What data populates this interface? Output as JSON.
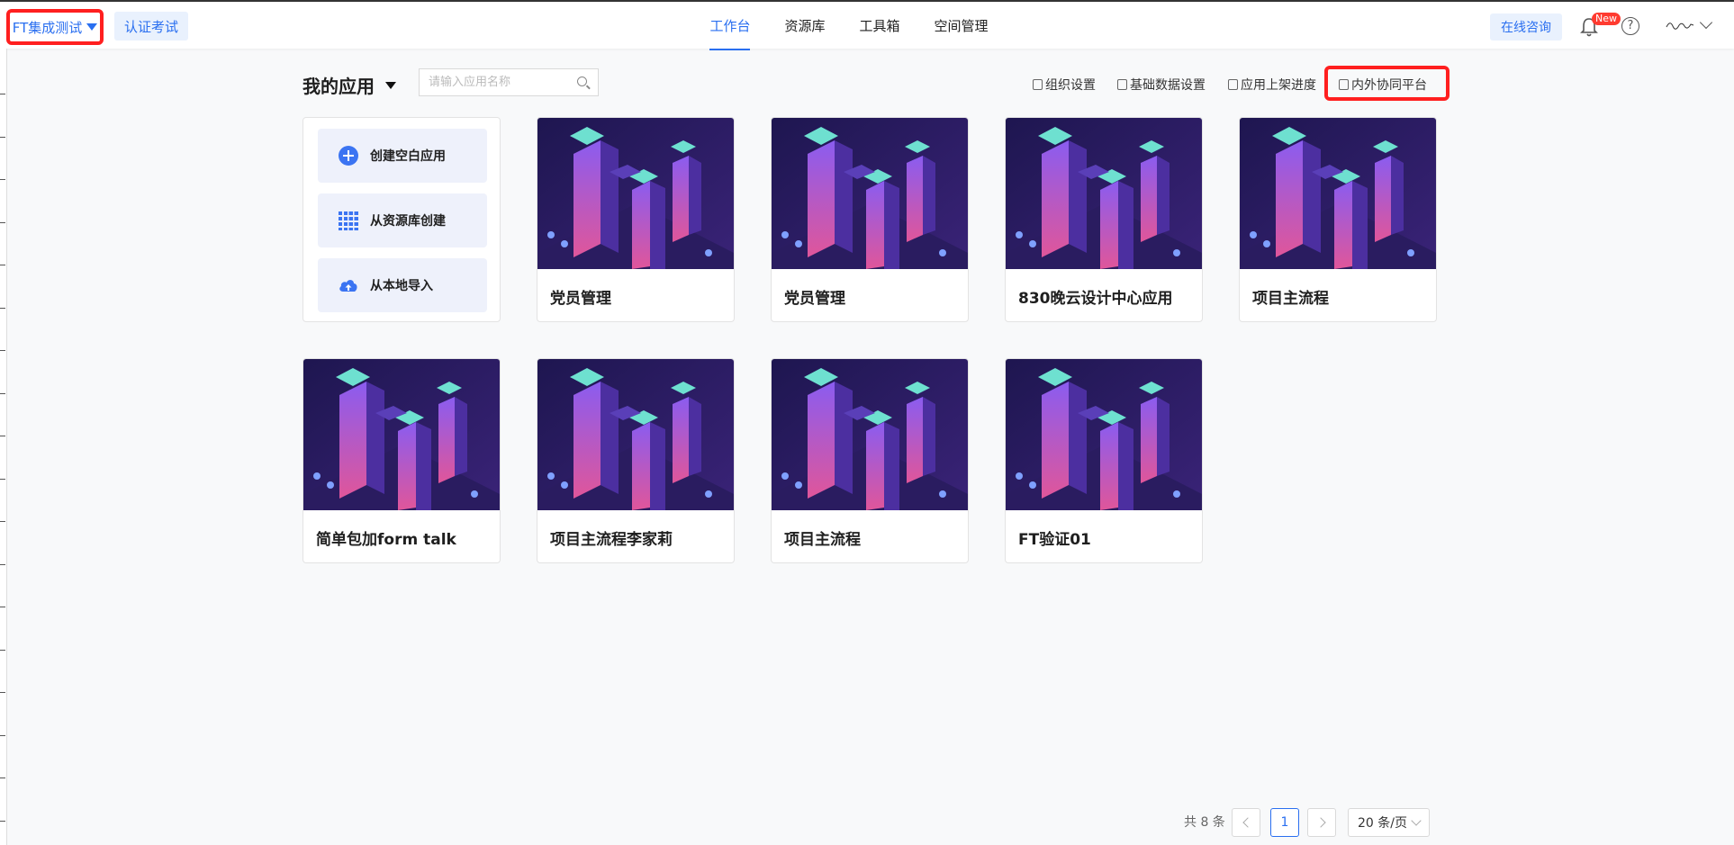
{
  "header": {
    "workspace_label": "FT集成测试",
    "exam_label": "认证考试",
    "tabs": [
      {
        "label": "工作台",
        "active": true
      },
      {
        "label": "资源库",
        "active": false
      },
      {
        "label": "工具箱",
        "active": false
      },
      {
        "label": "空间管理",
        "active": false
      }
    ],
    "consult_label": "在线咨询",
    "new_badge": "New",
    "help_glyph": "?"
  },
  "section": {
    "title": "我的应用",
    "search_placeholder": "请输入应用名称"
  },
  "toolbar": {
    "org_settings": "组织设置",
    "base_data_settings": "基础数据设置",
    "app_publish_progress": "应用上架进度",
    "collab_platform": "内外协同平台"
  },
  "create": {
    "blank": "创建空白应用",
    "from_library": "从资源库创建",
    "local_import": "从本地导入"
  },
  "apps": [
    {
      "name": "党员管理"
    },
    {
      "name": "党员管理"
    },
    {
      "name": "830晚云设计中心应用"
    },
    {
      "name": "项目主流程"
    },
    {
      "name": "简单包加form talk"
    },
    {
      "name": "项目主流程李家莉"
    },
    {
      "name": "项目主流程"
    },
    {
      "name": "FT验证01"
    }
  ],
  "pagination": {
    "total": "共 8 条",
    "current_page": "1",
    "page_size": "20 条/页"
  },
  "colors": {
    "accent": "#2a6ff0",
    "highlight": "#ff1f1f",
    "card_bg_dark": "#2b1a5e"
  }
}
